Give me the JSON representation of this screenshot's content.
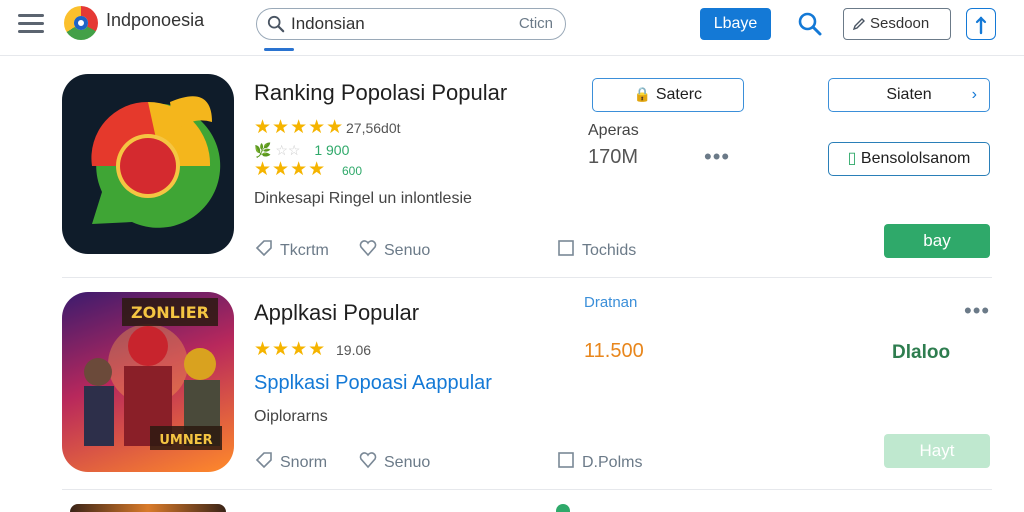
{
  "header": {
    "brand": "Indponoesia",
    "search_value": "Indonsian",
    "search_mode": "Cticn",
    "login_label": "Lbaye",
    "session_label": "Sesdoon"
  },
  "apps": [
    {
      "title": "Ranking Popolasi Popular",
      "rating_text": "27,56d0t",
      "sub_rating_text": "1 900",
      "sub_rating_text2": "600",
      "description": "Dinkesapi Ringel un inlontlesie",
      "meta_left": "Tkcrtm",
      "meta_mid": "Senuo",
      "meta_right": "Tochids",
      "info_label": "Aperas",
      "info_value": "170M",
      "button_save": "Saterc",
      "button_side": "Siaten",
      "button_secondary": "Bensololsanom",
      "button_primary": "bay",
      "stars": "★★★★★",
      "stars_sub": "★★★★"
    },
    {
      "title": "Applkasi Popular",
      "rating_text": "19.06",
      "subtitle_link": "Spplkasi Popoasi Aappular",
      "description": "Oiplorarns",
      "meta_left": "Snorm",
      "meta_mid": "Senuo",
      "meta_right": "D.Polms",
      "category_label": "Dratnan",
      "price_value": "11.500",
      "brand_green": "Dlaloo",
      "button_primary": "Hayt",
      "stars": "★★★★"
    }
  ],
  "colors": {
    "accent_blue": "#1479d6",
    "green_primary": "#2fa96a",
    "green_disabled": "#bfe8cf",
    "star_gold": "#f5b400",
    "price_orange": "#e8861c"
  }
}
